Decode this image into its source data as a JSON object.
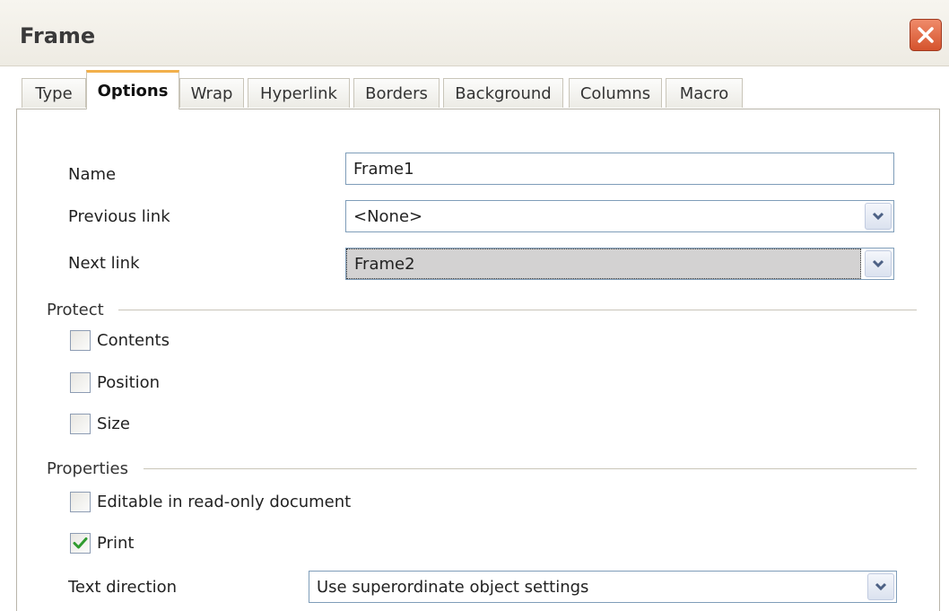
{
  "window": {
    "title": "Frame"
  },
  "tabs": [
    {
      "label": "Type"
    },
    {
      "label": "Options"
    },
    {
      "label": "Wrap"
    },
    {
      "label": "Hyperlink"
    },
    {
      "label": "Borders"
    },
    {
      "label": "Background"
    },
    {
      "label": "Columns"
    },
    {
      "label": "Macro"
    }
  ],
  "active_tab": "Options",
  "form": {
    "name_label": "Name",
    "name_value": "Frame1",
    "previous_link_label": "Previous link",
    "previous_link_value": "<None>",
    "next_link_label": "Next link",
    "next_link_value": "Frame2"
  },
  "protect": {
    "title": "Protect",
    "contents_label": "Contents",
    "contents_checked": false,
    "position_label": "Position",
    "position_checked": false,
    "size_label": "Size",
    "size_checked": false
  },
  "properties": {
    "title": "Properties",
    "editable_label": "Editable in read-only document",
    "editable_checked": false,
    "print_label": "Print",
    "print_checked": true,
    "text_direction_label": "Text direction",
    "text_direction_value": "Use superordinate object settings"
  },
  "colors": {
    "tab_accent": "#f2b04b",
    "close_button": "#d5532d",
    "check_mark": "#2f9b2f",
    "field_border": "#7f9db9"
  },
  "icons": {
    "close": "close-icon",
    "dropdown": "chevron-down-icon",
    "check": "checkmark-icon"
  }
}
